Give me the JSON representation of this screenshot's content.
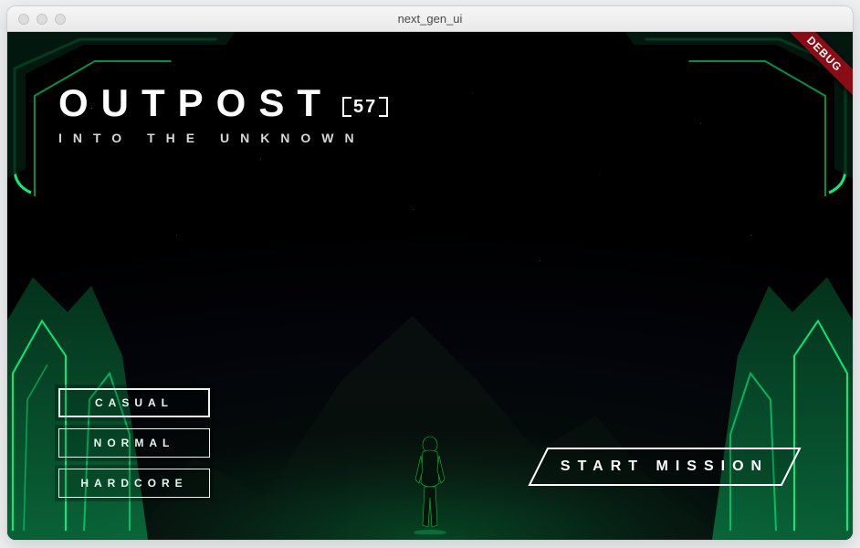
{
  "window": {
    "title": "next_gen_ui"
  },
  "debug_ribbon": "DEBUG",
  "title": {
    "main": "OUTPOST",
    "badge": "57",
    "subtitle": "INTO THE UNKNOWN"
  },
  "difficulty": {
    "options": [
      "CASUAL",
      "NORMAL",
      "HARDCORE"
    ]
  },
  "start": {
    "label": "START MISSION"
  },
  "colors": {
    "accent": "#00ff80",
    "accent_dim": "#0a6b3c"
  }
}
